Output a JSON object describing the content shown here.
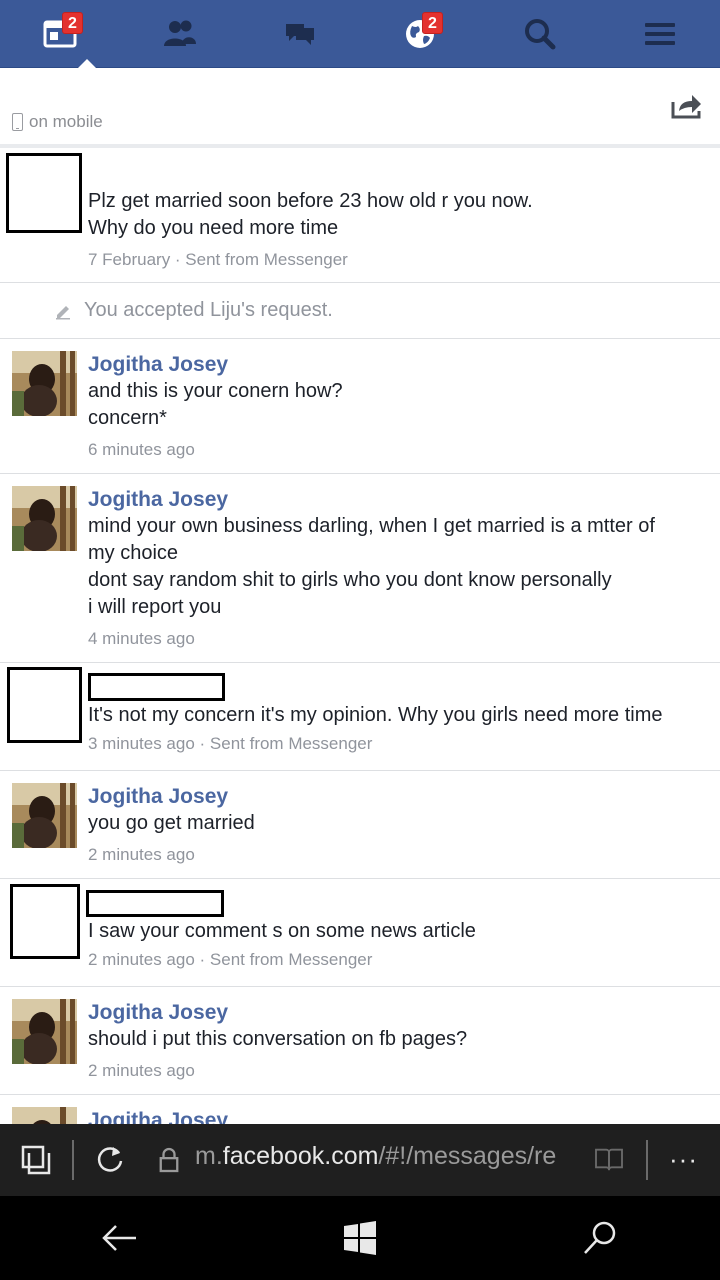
{
  "nav": {
    "items": [
      {
        "name": "news-feed",
        "badge": "2"
      },
      {
        "name": "friend-requests",
        "badge": ""
      },
      {
        "name": "messages",
        "badge": ""
      },
      {
        "name": "notifications",
        "badge": "2"
      },
      {
        "name": "search",
        "badge": ""
      },
      {
        "name": "menu",
        "badge": ""
      }
    ],
    "bg_color": "#3b5998",
    "badge_color": "#e3312f"
  },
  "header": {
    "status": "on mobile",
    "share_icon": "share-icon"
  },
  "messages": [
    {
      "type": "them-redacted",
      "lines": [
        "Plz get married soon before 23 how old r you now.",
        "Why do you need more time"
      ],
      "meta": "7 February · Sent from Messenger"
    },
    {
      "type": "system",
      "text": "You accepted Liju's request."
    },
    {
      "type": "me",
      "sender": "Jogitha Josey",
      "lines": [
        "and this is your conern how?",
        "concern*"
      ],
      "meta": "6 minutes ago"
    },
    {
      "type": "me",
      "sender": "Jogitha Josey",
      "lines": [
        "mind your own business darling, when I get married is a mtter of",
        "my choice",
        "dont say random shit to girls who you dont know personally",
        "i will report you"
      ],
      "meta": "4 minutes ago"
    },
    {
      "type": "them-redacted",
      "lines": [
        "It's not my concern it's my opinion. Why you girls need more time"
      ],
      "meta": "3 minutes ago · Sent from Messenger"
    },
    {
      "type": "me",
      "sender": "Jogitha Josey",
      "lines": [
        "you go get married"
      ],
      "meta": "2 minutes ago"
    },
    {
      "type": "them-redacted",
      "lines": [
        "I saw your comment s on some news article"
      ],
      "meta": "2 minutes ago · Sent from Messenger"
    },
    {
      "type": "me",
      "sender": "Jogitha Josey",
      "lines": [
        "should i put this conversation on fb pages?"
      ],
      "meta": "2 minutes ago"
    },
    {
      "type": "me-partial",
      "sender": "Jogitha Josey"
    }
  ],
  "browser": {
    "url_prefix": "m.",
    "url_domain": "facebook.com",
    "url_path": "/#!/messages/re",
    "more": "···"
  },
  "colors": {
    "sender_blue": "#4b67a1",
    "meta_gray": "#90949c"
  }
}
